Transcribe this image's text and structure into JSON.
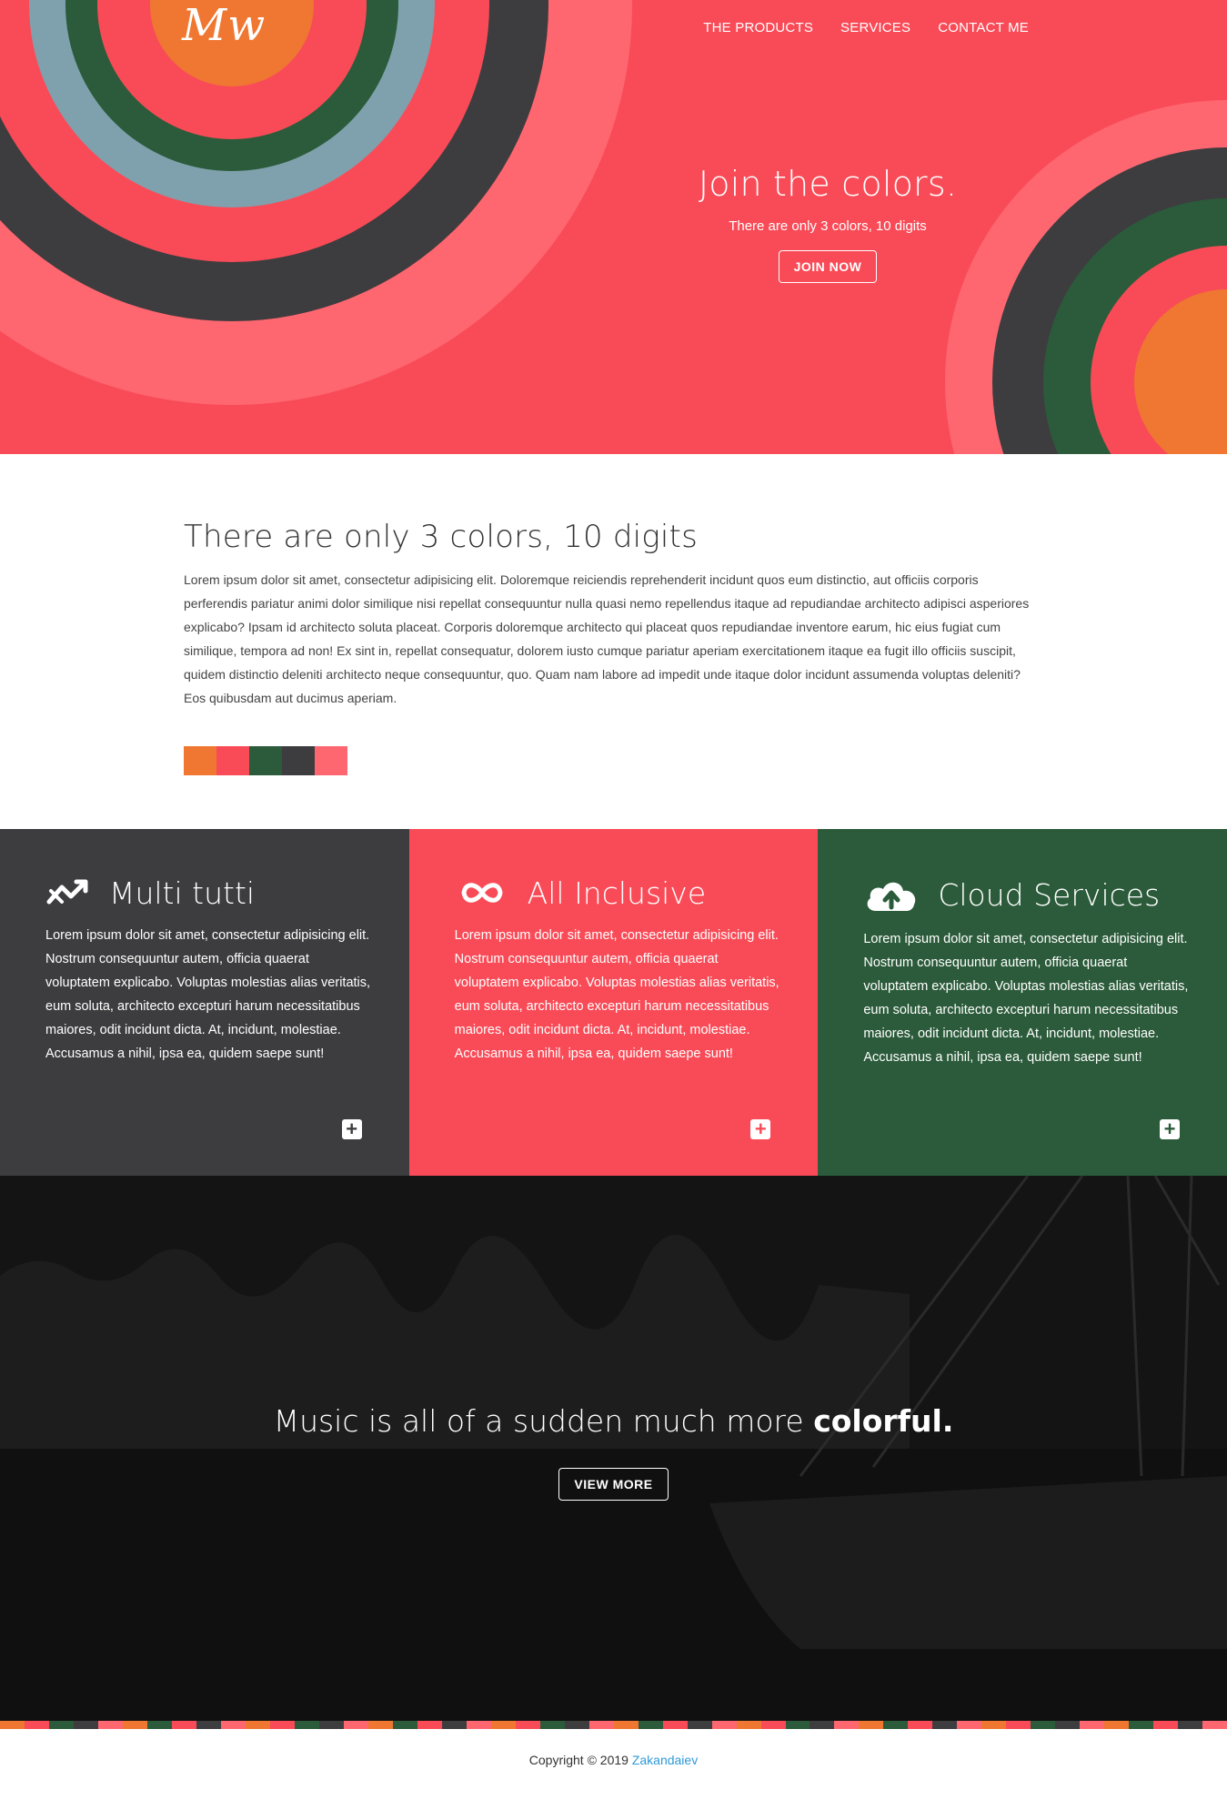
{
  "brand": {
    "logo_text": "Mw"
  },
  "nav": {
    "items": [
      {
        "label": "THE PRODUCTS"
      },
      {
        "label": "SERVICES"
      },
      {
        "label": "CONTACT ME"
      }
    ]
  },
  "hero": {
    "title": "Join the colors.",
    "subtitle": "There are only 3 colors, 10 digits",
    "button_label": "JOIN NOW"
  },
  "intro": {
    "title": "There are only 3 colors, 10 digits",
    "body": "Lorem ipsum dolor sit amet, consectetur adipisicing elit. Doloremque reiciendis reprehenderit incidunt quos eum distinctio, aut officiis corporis perferendis pariatur animi dolor similique nisi repellat consequuntur nulla quasi nemo repellendus itaque ad repudiandae architecto adipisci asperiores explicabo? Ipsam id architecto soluta placeat. Corporis doloremque architecto qui placeat quos repudiandae inventore earum, hic eius fugiat cum similique, tempora ad non! Ex sint in, repellat consequatur, dolorem iusto cumque pariatur aperiam exercitationem itaque ea fugit illo officiis suscipit, quidem distinctio deleniti architecto neque consequuntur, quo. Quam nam labore ad impedit unde itaque dolor incidunt assumenda voluptas deleniti? Eos quibusdam aut ducimus aperiam."
  },
  "palette": {
    "orange": "#ef7731",
    "red": "#f94b57",
    "green": "#2b5b3a",
    "dark": "#3d3d3f",
    "pink": "#fe6770",
    "blue_grey": "#7fa1ad"
  },
  "features": [
    {
      "icon": "trend-arrows-icon",
      "title": "Multi tutti",
      "body": "Lorem ipsum dolor sit amet, consectetur adipisicing elit. Nostrum consequuntur autem, officia quaerat voluptatem explicabo. Voluptas molestias alias veritatis, eum soluta, architecto excepturi harum necessitatibus maiores, odit incidunt dicta. At, incidunt, molestiae. Accusamus a nihil, ipsa ea, quidem saepe sunt!",
      "bg": "#3d3d3f",
      "plus": "+"
    },
    {
      "icon": "infinity-icon",
      "title": "All Inclusive",
      "body": "Lorem ipsum dolor sit amet, consectetur adipisicing elit. Nostrum consequuntur autem, officia quaerat voluptatem explicabo. Voluptas molestias alias veritatis, eum soluta, architecto excepturi harum necessitatibus maiores, odit incidunt dicta. At, incidunt, molestiae. Accusamus a nihil, ipsa ea, quidem saepe sunt!",
      "bg": "#f94b57",
      "plus": "+"
    },
    {
      "icon": "cloud-upload-icon",
      "title": "Cloud Services",
      "body": "Lorem ipsum dolor sit amet, consectetur adipisicing elit. Nostrum consequuntur autem, officia quaerat voluptatem explicabo. Voluptas molestias alias veritatis, eum soluta, architecto excepturi harum necessitatibus maiores, odit incidunt dicta. At, incidunt, molestiae. Accusamus a nihil, ipsa ea, quidem saepe sunt!",
      "bg": "#2b5b3a",
      "plus": "+"
    }
  ],
  "cta": {
    "title_plain": "Music is all of a sudden much more ",
    "title_bold": "colorful.",
    "button_label": "VIEW MORE"
  },
  "footer": {
    "copyright": "Copyright © 2019 ",
    "author": "Zakandaiev"
  }
}
